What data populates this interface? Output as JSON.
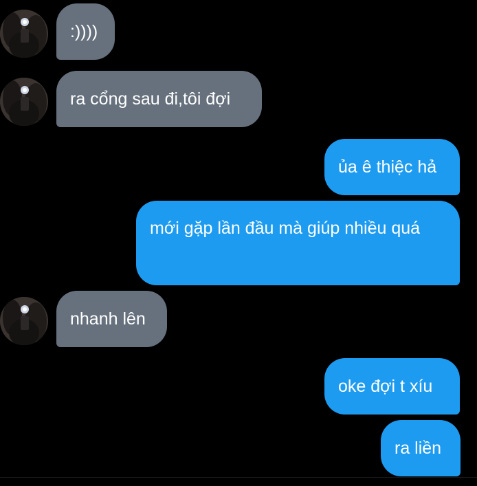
{
  "conversation": {
    "messages": [
      {
        "side": "received",
        "text": ":))))"
      },
      {
        "side": "received",
        "text": "ra cổng sau đi,tôi đợi"
      },
      {
        "side": "sent",
        "text": "ủa ê thiệc hả"
      },
      {
        "side": "sent",
        "text": "mới gặp lần đầu mà giúp nhiều quá"
      },
      {
        "side": "received",
        "text": "nhanh lên"
      },
      {
        "side": "sent",
        "text": "oke đợi t xíu"
      },
      {
        "side": "sent",
        "text": "ra liền"
      }
    ]
  },
  "colors": {
    "background": "#000000",
    "received_bubble": "#66717d",
    "sent_bubble": "#1d9bf0",
    "text": "#ffffff"
  },
  "icons": {
    "avatar": "profile-photo-avatar"
  }
}
